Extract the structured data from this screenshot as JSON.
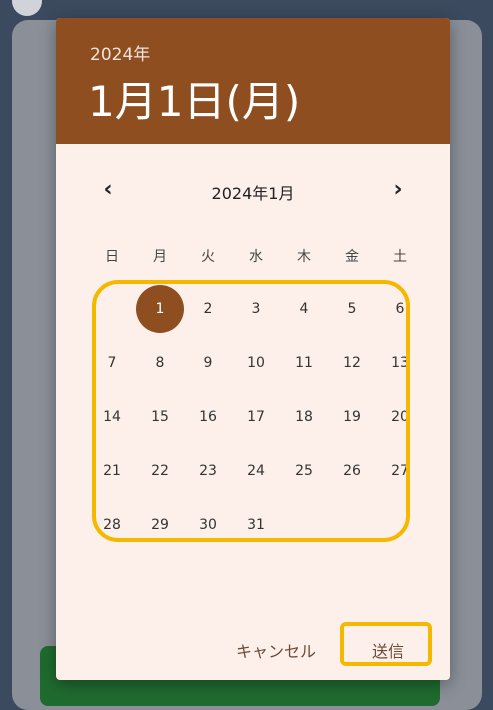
{
  "dialog": {
    "header": {
      "year": "2024年",
      "date": "1月1日(月)"
    },
    "month_label": "2024年1月",
    "prev_icon": "‹",
    "next_icon": "›",
    "weekdays": [
      "日",
      "月",
      "火",
      "水",
      "木",
      "金",
      "土"
    ],
    "weeks": [
      [
        "",
        "1",
        "2",
        "3",
        "4",
        "5",
        "6"
      ],
      [
        "7",
        "8",
        "9",
        "10",
        "11",
        "12",
        "13"
      ],
      [
        "14",
        "15",
        "16",
        "17",
        "18",
        "19",
        "20"
      ],
      [
        "21",
        "22",
        "23",
        "24",
        "25",
        "26",
        "27"
      ],
      [
        "28",
        "29",
        "30",
        "31",
        "",
        "",
        ""
      ]
    ],
    "selected_day": "1",
    "actions": {
      "cancel": "キャンセル",
      "submit": "送信"
    }
  },
  "colors": {
    "header_bg": "#8e4e1f",
    "dialog_bg": "#fdf0eb",
    "highlight": "#f5b800",
    "overlay_bg": "#3b4a5e"
  }
}
